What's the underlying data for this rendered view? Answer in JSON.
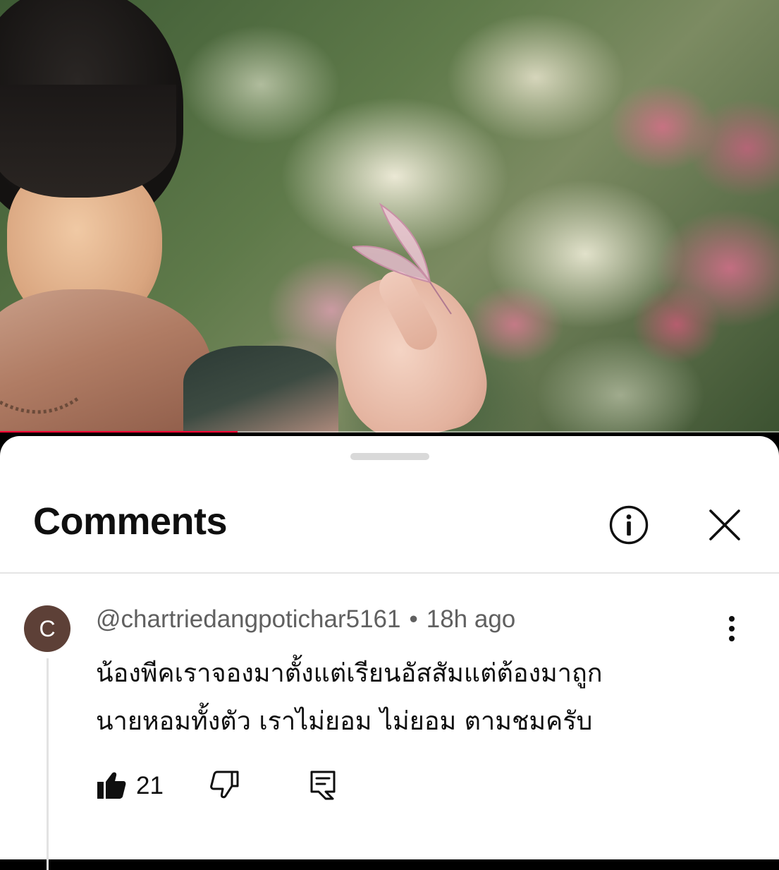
{
  "video": {
    "progress_fraction": 0.305,
    "accent_color": "#ff0033",
    "icons": [
      "butterfly"
    ]
  },
  "comments_panel": {
    "title": "Comments",
    "icons": [
      "info-icon",
      "close-icon"
    ]
  },
  "comment": {
    "avatar_letter": "C",
    "avatar_color": "#5d4037",
    "author": "@chartriedangpotichar5161",
    "separator": "•",
    "timestamp": "18h ago",
    "text_line1": "น้องพีคเราจองมาตั้งแต่เรียนอัสสัมแต่ต้องมาถูก",
    "text_line2": "นายหอมทั้งตัว เราไม่ยอม ไม่ยอม ตามชมครับ",
    "like_count": "21",
    "icons": [
      "more-vertical-icon",
      "thumbs-up-icon",
      "thumbs-down-icon",
      "reply-icon"
    ]
  }
}
